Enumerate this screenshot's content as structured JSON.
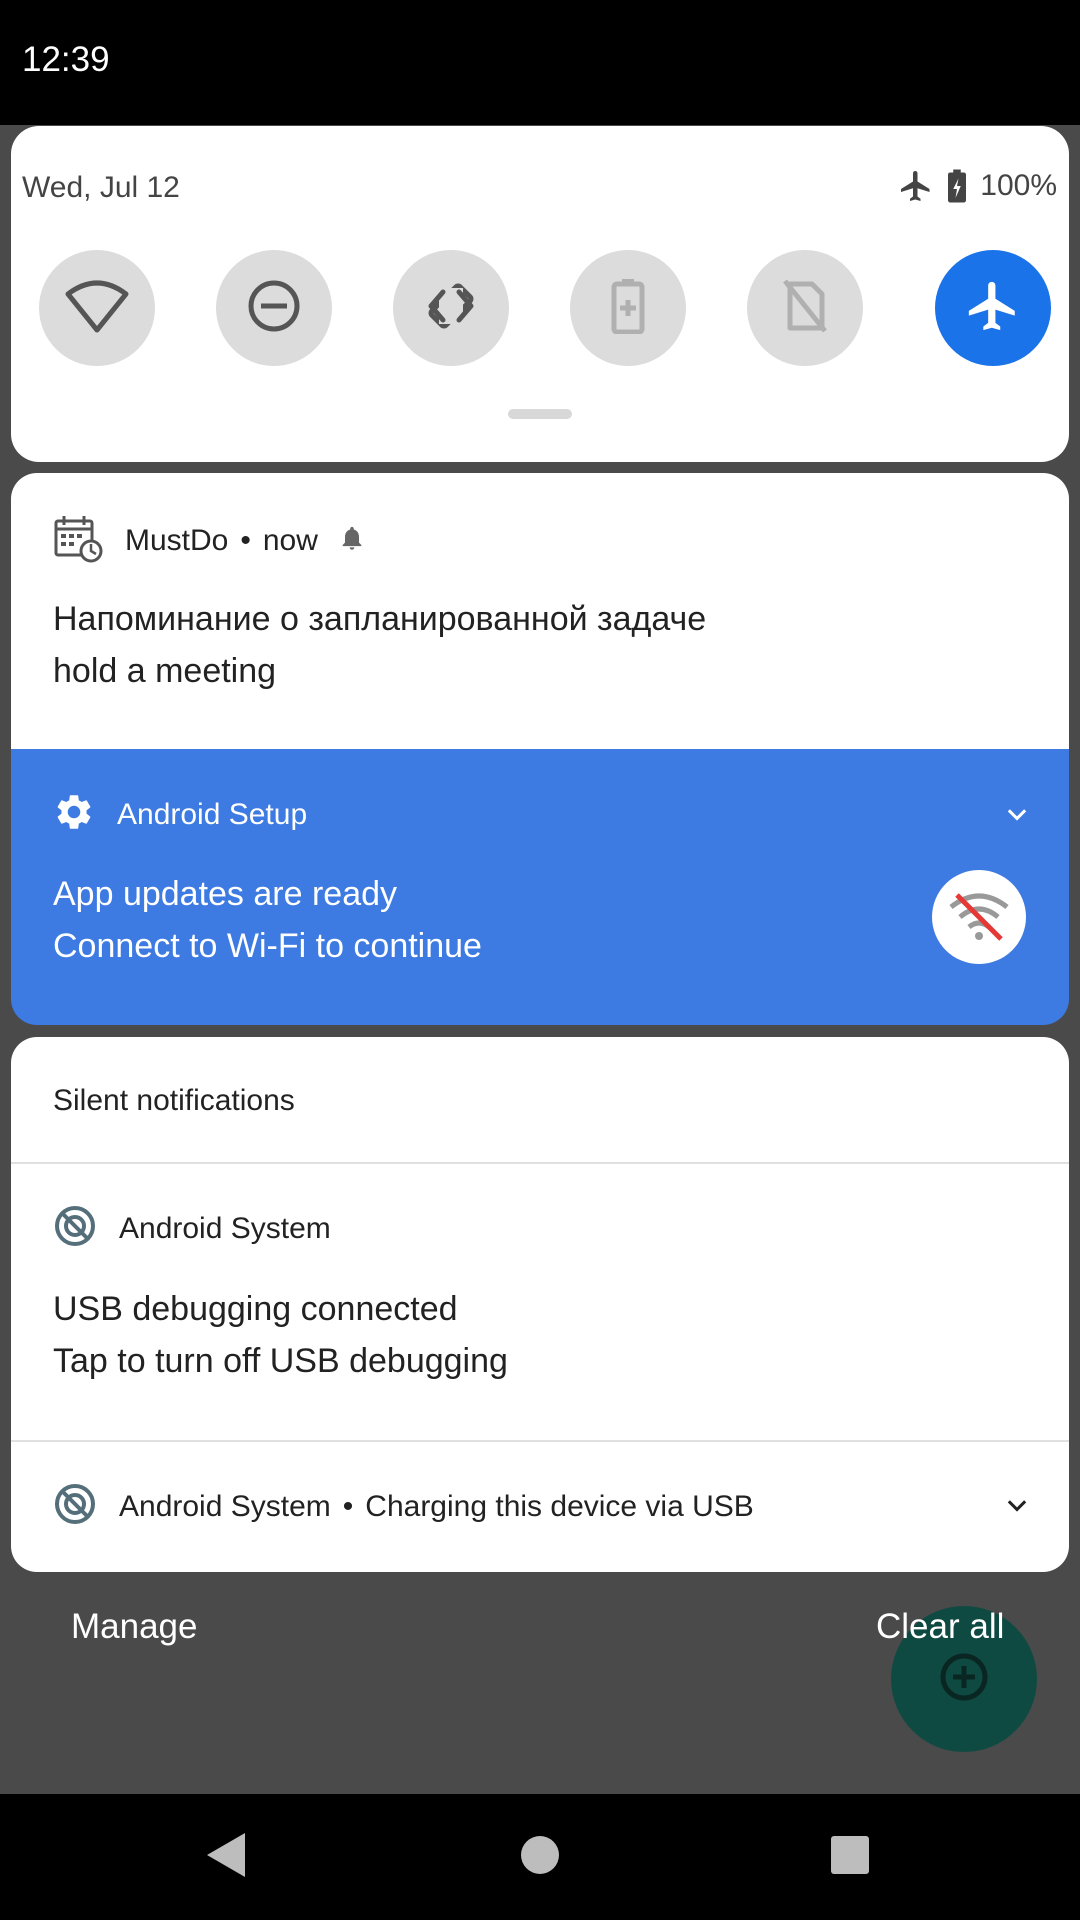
{
  "status_bar": {
    "time": "12:39"
  },
  "quick_settings": {
    "date": "Wed, Jul 12",
    "battery_percent": "100%",
    "tiles": [
      {
        "icon": "wifi-icon",
        "active": false
      },
      {
        "icon": "do-not-disturb-icon",
        "active": false
      },
      {
        "icon": "auto-rotate-icon",
        "active": false
      },
      {
        "icon": "battery-saver-icon",
        "active": false
      },
      {
        "icon": "mobile-data-off-icon",
        "active": false
      },
      {
        "icon": "airplane-mode-icon",
        "active": true
      }
    ],
    "accent_color": "#1a73e8"
  },
  "notifications": {
    "mustdo": {
      "app": "MustDo",
      "separator": "•",
      "time": "now",
      "title": "Напоминание о запланированной задаче",
      "text": "hold a meeting"
    },
    "setup": {
      "app": "Android Setup",
      "title": "App updates are ready",
      "text": "Connect to Wi-Fi to continue",
      "background_color": "#3d7ae1"
    },
    "silent": {
      "section_title": "Silent notifications",
      "usb_debug": {
        "app": "Android System",
        "title": "USB debugging connected",
        "text": "Tap to turn off USB debugging"
      },
      "charging": {
        "app": "Android System",
        "separator": "•",
        "summary": "Charging this device via USB"
      }
    }
  },
  "footer": {
    "manage_label": "Manage",
    "clear_all_label": "Clear all"
  },
  "fab": {
    "icon": "add-circle-icon",
    "color": "#0f4a42"
  },
  "nav_bar": {
    "buttons": [
      "back-icon",
      "home-icon",
      "recents-icon"
    ]
  }
}
